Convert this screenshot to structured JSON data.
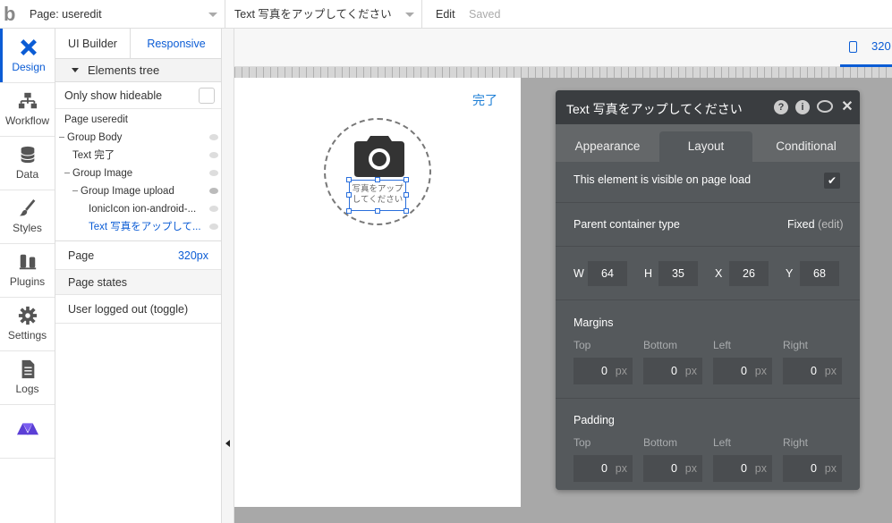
{
  "topbar": {
    "logo": "b",
    "page_select": "Page: useredit",
    "element_select": "Text 写真をアップしてください",
    "edit": "Edit",
    "saved": "Saved"
  },
  "leftnav": [
    {
      "label": "Design",
      "icon": "design-icon",
      "active": true
    },
    {
      "label": "Workflow",
      "icon": "workflow-icon"
    },
    {
      "label": "Data",
      "icon": "database-icon"
    },
    {
      "label": "Styles",
      "icon": "brush-icon"
    },
    {
      "label": "Plugins",
      "icon": "plug-icon"
    },
    {
      "label": "Settings",
      "icon": "gear-icon"
    },
    {
      "label": "Logs",
      "icon": "document-icon"
    },
    {
      "label": "",
      "icon": "triangle-logo-icon"
    }
  ],
  "panel": {
    "tab_ui_builder": "UI Builder",
    "tab_responsive": "Responsive",
    "elements_tree": "Elements tree",
    "only_show_hideable": "Only show hideable",
    "tree": [
      {
        "label": "Page useredit"
      },
      {
        "label": "Group Body"
      },
      {
        "label": "Text 完了"
      },
      {
        "label": "Group Image"
      },
      {
        "label": "Group Image upload"
      },
      {
        "label": "IonicIcon ion-android-..."
      },
      {
        "label": "Text 写真をアップして..."
      }
    ],
    "page_label": "Page",
    "page_value": "320px",
    "page_states": "Page states",
    "user_logged_out": "User logged out (toggle)"
  },
  "canvas": {
    "responsive_width": "320",
    "done_text": "完了",
    "upload_text": "写真をアップしてください"
  },
  "editor": {
    "title": "Text 写真をアップしてください",
    "tabs": [
      "Appearance",
      "Layout",
      "Conditional"
    ],
    "visible_on_load": "This element is visible on page load",
    "parent_container_type": "Parent container type",
    "fixed": "Fixed",
    "edit": "(edit)",
    "w_label": "W",
    "w": "64",
    "h_label": "H",
    "h": "35",
    "x_label": "X",
    "x": "26",
    "y_label": "Y",
    "y": "68",
    "margins": "Margins",
    "padding": "Padding",
    "sides": [
      "Top",
      "Bottom",
      "Left",
      "Right"
    ],
    "zero": "0",
    "unit": "px"
  }
}
